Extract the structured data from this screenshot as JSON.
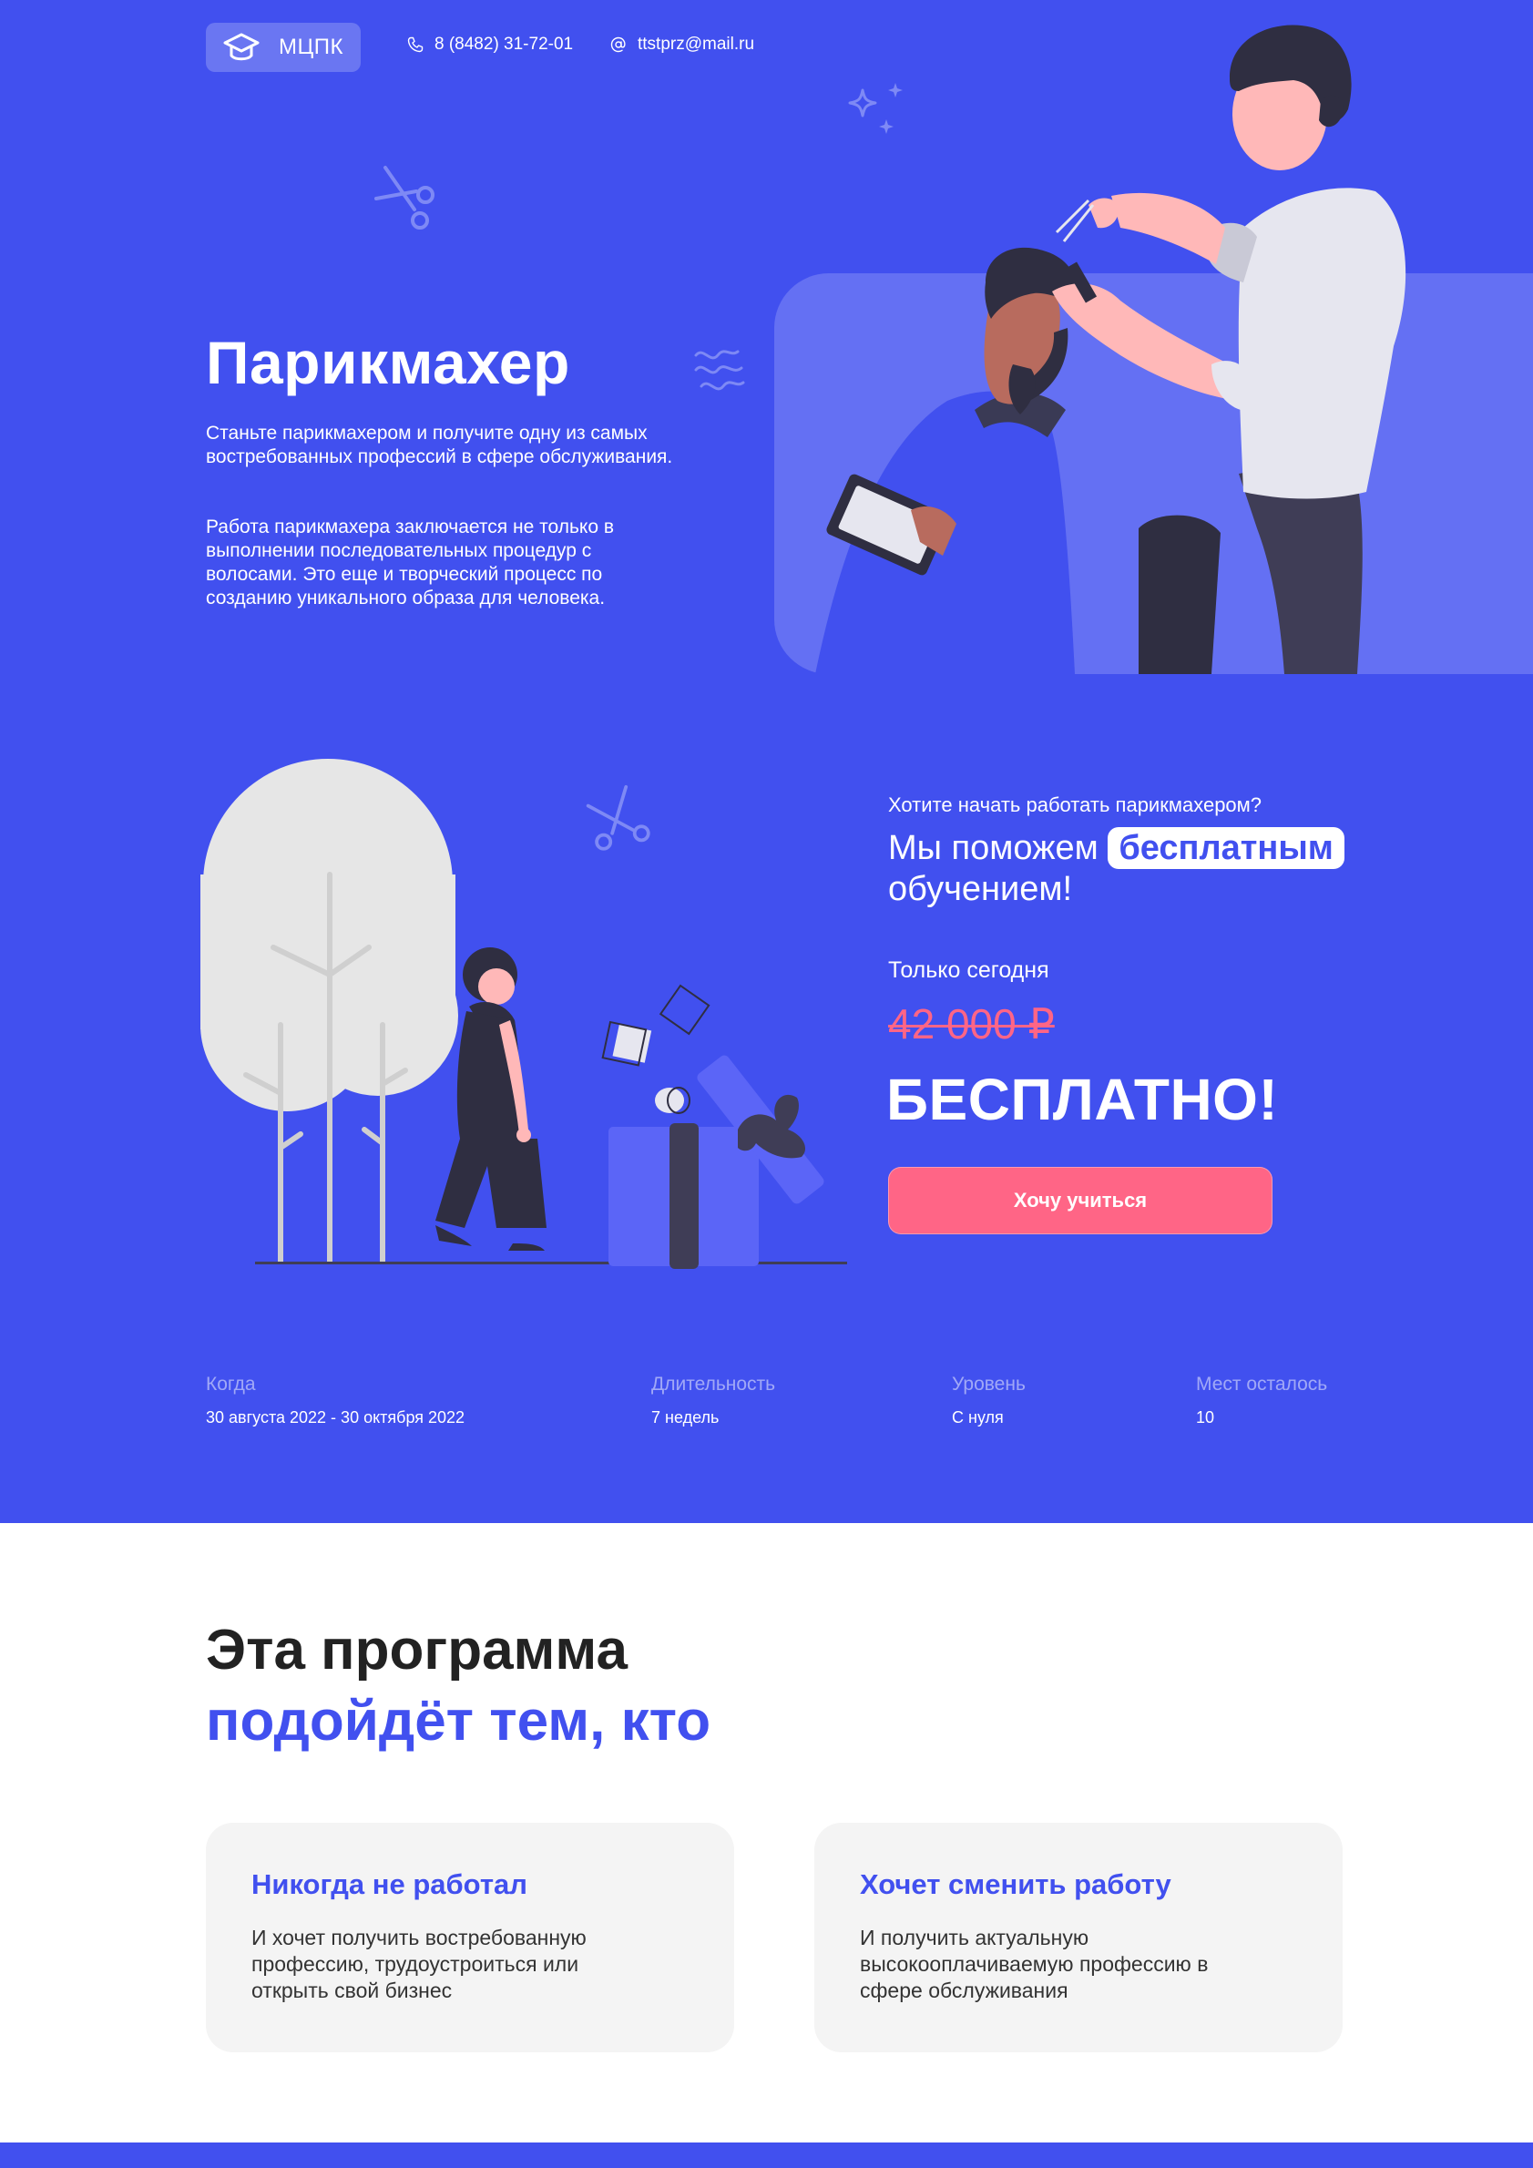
{
  "header": {
    "logo_text": "МЦПК",
    "phone": "8 (8482) 31-72-01",
    "email": "ttstprz@mail.ru"
  },
  "hero": {
    "title": "Парикмахер",
    "paragraph1": "Станьте парикмахером и получите одну из самых востребованных профессий в сфере обслуживания.",
    "paragraph2": "Работа парикмахера заключается не только в выполнении последовательных процедур с волосами. Это еще и творческий процесс по созданию уникального образа для человека."
  },
  "offer": {
    "question": "Хотите начать работать парикмахером?",
    "headline_before": "Мы поможем",
    "headline_highlight": "бесплатным",
    "headline_after": "обучением!",
    "today_label": "Только сегодня",
    "old_price": "42 000 ₽",
    "free_label": "БЕСПЛАТНО!",
    "cta_label": "Хочу учиться"
  },
  "info": [
    {
      "label": "Когда",
      "value": "30 августа 2022 - 30 октября 2022"
    },
    {
      "label": "Длительность",
      "value": "7 недель"
    },
    {
      "label": "Уровень",
      "value": "С нуля"
    },
    {
      "label": "Мест осталось",
      "value": "10"
    }
  ],
  "program": {
    "title_line1": "Эта программа",
    "title_line2": "подойдёт тем, кто",
    "cards": [
      {
        "title": "Никогда не работал",
        "text": "И хочет получить востребованную профессию, трудоустроиться или открыть свой бизнес"
      },
      {
        "title": "Хочет сменить работу",
        "text": "И получить актуальную высокооплачиваемую профессию в сфере обслуживания"
      }
    ]
  },
  "colors": {
    "primary": "#4150EF",
    "accent_pink": "#FF6586",
    "card_bg": "#F4F4F4",
    "text_dark": "#222222"
  },
  "icons": [
    "graduation-cap-icon",
    "phone-icon",
    "at-sign-icon",
    "scissors-icon",
    "sparkle-icon",
    "wave-icon"
  ]
}
